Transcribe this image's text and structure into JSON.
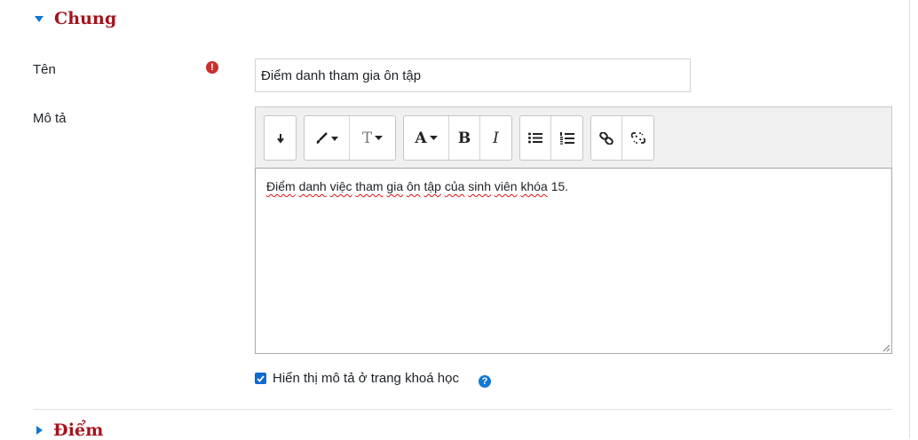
{
  "sections": {
    "general": {
      "title": "Chung"
    },
    "grade": {
      "title": "Điểm"
    }
  },
  "fields": {
    "name": {
      "label": "Tên",
      "value": "Điểm danh tham gia ôn tập"
    },
    "description": {
      "label": "Mô tả",
      "text_words": [
        {
          "w": "Điểm",
          "spell": true
        },
        {
          "w": " ",
          "spell": false
        },
        {
          "w": "danh",
          "spell": true
        },
        {
          "w": " ",
          "spell": false
        },
        {
          "w": "việc",
          "spell": true
        },
        {
          "w": " ",
          "spell": false
        },
        {
          "w": "tham",
          "spell": true
        },
        {
          "w": " ",
          "spell": false
        },
        {
          "w": "gia",
          "spell": true
        },
        {
          "w": " ",
          "spell": false
        },
        {
          "w": "ôn",
          "spell": true
        },
        {
          "w": " ",
          "spell": false
        },
        {
          "w": "tập",
          "spell": true
        },
        {
          "w": " ",
          "spell": false
        },
        {
          "w": "của",
          "spell": true
        },
        {
          "w": " ",
          "spell": false
        },
        {
          "w": "sinh",
          "spell": true
        },
        {
          "w": " ",
          "spell": false
        },
        {
          "w": "viên",
          "spell": true
        },
        {
          "w": " ",
          "spell": false
        },
        {
          "w": "khóa",
          "spell": true
        },
        {
          "w": " 15.",
          "spell": false
        }
      ]
    },
    "show_description": {
      "label": "Hiển thị mô tả ở trang khoá học",
      "checked": true
    }
  },
  "toolbar": {
    "buttons": [
      "toggle-toolbar",
      "paint-brush",
      "text-style",
      "font-color",
      "bold",
      "italic",
      "unordered-list",
      "ordered-list",
      "link",
      "unlink"
    ],
    "bold_glyph": "B",
    "italic_glyph": "I",
    "font_color_glyph": "A",
    "text_style_glyph": "T"
  },
  "icons": {
    "required": "required-icon",
    "help": "help-icon"
  },
  "colors": {
    "section_title": "#a5131c",
    "accent": "#1177d1",
    "required": "#c9302c"
  }
}
